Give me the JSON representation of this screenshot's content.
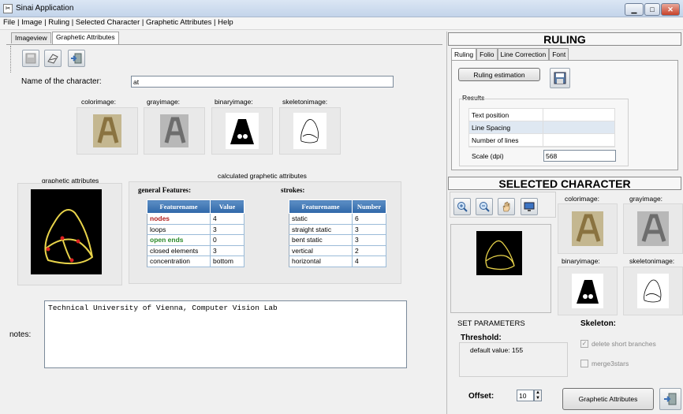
{
  "window": {
    "title": "Sinai Application"
  },
  "menu": [
    "File",
    "Image",
    "Ruling",
    "Selected Character",
    "Graphetic Attributes",
    "Help"
  ],
  "tabs": {
    "imageview": "Imageview",
    "graphetic": "Graphetic Attributes"
  },
  "name_field": {
    "label": "Name of the character:",
    "value": "at"
  },
  "image_labels": {
    "color": "colorimage:",
    "gray": "grayimage:",
    "binary": "binaryimage:",
    "skeleton": "skeletonimage:"
  },
  "graphetic_attributes_label": "graphetic attributes",
  "calculated_label": "calculated graphetic attributes",
  "general_features": {
    "title": "general Features:",
    "headers": [
      "Featurename",
      "Value"
    ],
    "rows": [
      {
        "name": "nodes",
        "value": "4",
        "style": "red"
      },
      {
        "name": "loops",
        "value": "3",
        "style": ""
      },
      {
        "name": "open ends",
        "value": "0",
        "style": "green"
      },
      {
        "name": "closed elements",
        "value": "3",
        "style": ""
      },
      {
        "name": "concentration",
        "value": "bottom",
        "style": ""
      }
    ]
  },
  "strokes": {
    "title": "strokes:",
    "headers": [
      "Featurename",
      "Number"
    ],
    "rows": [
      {
        "name": "static",
        "value": "6"
      },
      {
        "name": "straight static",
        "value": "3"
      },
      {
        "name": "bent static",
        "value": "3"
      },
      {
        "name": "vertical",
        "value": "2"
      },
      {
        "name": "horizontal",
        "value": "4"
      }
    ]
  },
  "notes": {
    "label": "notes:",
    "value": "Technical University of Vienna, Computer Vision Lab"
  },
  "ruling": {
    "header": "RULING",
    "tabs": [
      "Ruling",
      "Folio",
      "Line Correction",
      "Font"
    ],
    "estimation_button": "Ruling estimation",
    "results_label": "Results",
    "rows": [
      {
        "label": "Text position",
        "value": ""
      },
      {
        "label": "Line Spacing",
        "value": ""
      },
      {
        "label": "Number of lines",
        "value": ""
      }
    ],
    "scale_label": "Scale (dpi)",
    "scale_value": "568"
  },
  "selected": {
    "header": "SELECTED CHARACTER",
    "labels": {
      "color": "colorimage:",
      "gray": "grayimage:",
      "binary": "binaryimage:",
      "skeleton": "skeletonimage:"
    },
    "set_parameters": "SET PARAMETERS",
    "threshold_label": "Threshold:",
    "threshold_default": "default value: 155",
    "skeleton_label": "Skeleton:",
    "delete_short": "delete short branches",
    "merge3stars": "merge3stars",
    "offset_label": "Offset:",
    "offset_value": "10",
    "graphetic_button": "Graphetic Attributes"
  },
  "colors": {
    "table_header": "#3b72b0",
    "nodes": "#b01e1e",
    "open_ends": "#2b8a2b",
    "skeleton_line": "#e8d34a"
  }
}
